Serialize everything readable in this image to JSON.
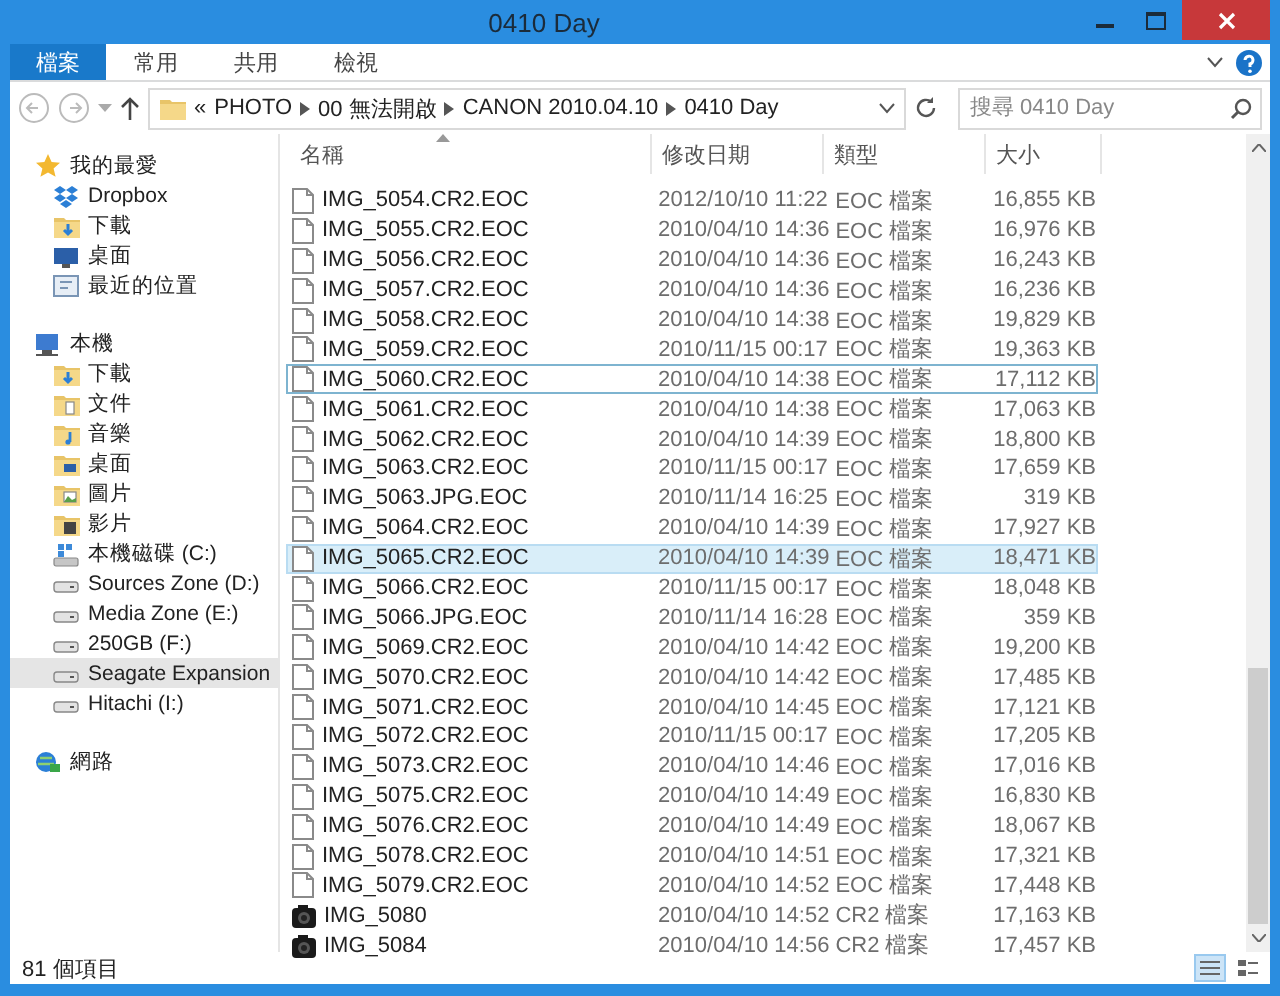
{
  "window": {
    "title": "0410 Day"
  },
  "ribbon": {
    "tabs": [
      {
        "label": "檔案",
        "selected": true
      },
      {
        "label": "常用",
        "selected": false
      },
      {
        "label": "共用",
        "selected": false
      },
      {
        "label": "檢視",
        "selected": false
      }
    ]
  },
  "address_bar": {
    "overflow": "«",
    "path": [
      "PHOTO",
      "00 無法開啟",
      "CANON 2010.04.10",
      "0410 Day"
    ]
  },
  "search": {
    "placeholder": "搜尋 0410 Day"
  },
  "navigation": [
    {
      "label": "我的最愛",
      "kind": "star",
      "selected": false,
      "children": [
        {
          "label": "Dropbox",
          "kind": "dropbox",
          "selected": false
        },
        {
          "label": "下載",
          "kind": "folder-download",
          "selected": false
        },
        {
          "label": "桌面",
          "kind": "desktop",
          "selected": false
        },
        {
          "label": "最近的位置",
          "kind": "recent",
          "selected": false
        }
      ]
    },
    {
      "label": "本機",
      "kind": "computer",
      "selected": false,
      "children": [
        {
          "label": "下載",
          "kind": "folder-download",
          "selected": false
        },
        {
          "label": "文件",
          "kind": "folder-doc",
          "selected": false
        },
        {
          "label": "音樂",
          "kind": "folder-music",
          "selected": false
        },
        {
          "label": "桌面",
          "kind": "folder-desktop",
          "selected": false
        },
        {
          "label": "圖片",
          "kind": "folder-picture",
          "selected": false
        },
        {
          "label": "影片",
          "kind": "folder-video",
          "selected": false
        },
        {
          "label": "本機磁碟 (C:)",
          "kind": "system-drive",
          "selected": false
        },
        {
          "label": "Sources Zone (D:)",
          "kind": "drive",
          "selected": false
        },
        {
          "label": "Media Zone (E:)",
          "kind": "drive",
          "selected": false
        },
        {
          "label": "250GB (F:)",
          "kind": "drive",
          "selected": false
        },
        {
          "label": "Seagate Expansion",
          "kind": "drive",
          "selected": true
        },
        {
          "label": "Hitachi (I:)",
          "kind": "drive",
          "selected": false
        }
      ]
    },
    {
      "label": "網路",
      "kind": "network",
      "selected": false
    }
  ],
  "file_list": {
    "columns": [
      {
        "label": "名稱",
        "sorted": true
      },
      {
        "label": "修改日期",
        "sorted": false
      },
      {
        "label": "類型",
        "sorted": false
      },
      {
        "label": "大小",
        "sorted": false
      }
    ],
    "rows": [
      {
        "name": "IMG_5054.CR2.EOC",
        "modified": "2012/10/10 11:22",
        "type": "EOC 檔案",
        "size": "16,855 KB",
        "kind": "eoc",
        "selected": false,
        "focused": false
      },
      {
        "name": "IMG_5055.CR2.EOC",
        "modified": "2010/04/10 14:36",
        "type": "EOC 檔案",
        "size": "16,976 KB",
        "kind": "eoc",
        "selected": false,
        "focused": false
      },
      {
        "name": "IMG_5056.CR2.EOC",
        "modified": "2010/04/10 14:36",
        "type": "EOC 檔案",
        "size": "16,243 KB",
        "kind": "eoc",
        "selected": false,
        "focused": false
      },
      {
        "name": "IMG_5057.CR2.EOC",
        "modified": "2010/04/10 14:36",
        "type": "EOC 檔案",
        "size": "16,236 KB",
        "kind": "eoc",
        "selected": false,
        "focused": false
      },
      {
        "name": "IMG_5058.CR2.EOC",
        "modified": "2010/04/10 14:38",
        "type": "EOC 檔案",
        "size": "19,829 KB",
        "kind": "eoc",
        "selected": false,
        "focused": false
      },
      {
        "name": "IMG_5059.CR2.EOC",
        "modified": "2010/11/15 00:17",
        "type": "EOC 檔案",
        "size": "19,363 KB",
        "kind": "eoc",
        "selected": false,
        "focused": false
      },
      {
        "name": "IMG_5060.CR2.EOC",
        "modified": "2010/04/10 14:38",
        "type": "EOC 檔案",
        "size": "17,112 KB",
        "kind": "eoc",
        "selected": false,
        "focused": true
      },
      {
        "name": "IMG_5061.CR2.EOC",
        "modified": "2010/04/10 14:38",
        "type": "EOC 檔案",
        "size": "17,063 KB",
        "kind": "eoc",
        "selected": false,
        "focused": false
      },
      {
        "name": "IMG_5062.CR2.EOC",
        "modified": "2010/04/10 14:39",
        "type": "EOC 檔案",
        "size": "18,800 KB",
        "kind": "eoc",
        "selected": false,
        "focused": false
      },
      {
        "name": "IMG_5063.CR2.EOC",
        "modified": "2010/11/15 00:17",
        "type": "EOC 檔案",
        "size": "17,659 KB",
        "kind": "eoc",
        "selected": false,
        "focused": false
      },
      {
        "name": "IMG_5063.JPG.EOC",
        "modified": "2010/11/14 16:25",
        "type": "EOC 檔案",
        "size": "319 KB",
        "kind": "eoc",
        "selected": false,
        "focused": false
      },
      {
        "name": "IMG_5064.CR2.EOC",
        "modified": "2010/04/10 14:39",
        "type": "EOC 檔案",
        "size": "17,927 KB",
        "kind": "eoc",
        "selected": false,
        "focused": false
      },
      {
        "name": "IMG_5065.CR2.EOC",
        "modified": "2010/04/10 14:39",
        "type": "EOC 檔案",
        "size": "18,471 KB",
        "kind": "eoc",
        "selected": true,
        "focused": false
      },
      {
        "name": "IMG_5066.CR2.EOC",
        "modified": "2010/11/15 00:17",
        "type": "EOC 檔案",
        "size": "18,048 KB",
        "kind": "eoc",
        "selected": false,
        "focused": false
      },
      {
        "name": "IMG_5066.JPG.EOC",
        "modified": "2010/11/14 16:28",
        "type": "EOC 檔案",
        "size": "359 KB",
        "kind": "eoc",
        "selected": false,
        "focused": false
      },
      {
        "name": "IMG_5069.CR2.EOC",
        "modified": "2010/04/10 14:42",
        "type": "EOC 檔案",
        "size": "19,200 KB",
        "kind": "eoc",
        "selected": false,
        "focused": false
      },
      {
        "name": "IMG_5070.CR2.EOC",
        "modified": "2010/04/10 14:42",
        "type": "EOC 檔案",
        "size": "17,485 KB",
        "kind": "eoc",
        "selected": false,
        "focused": false
      },
      {
        "name": "IMG_5071.CR2.EOC",
        "modified": "2010/04/10 14:45",
        "type": "EOC 檔案",
        "size": "17,121 KB",
        "kind": "eoc",
        "selected": false,
        "focused": false
      },
      {
        "name": "IMG_5072.CR2.EOC",
        "modified": "2010/11/15 00:17",
        "type": "EOC 檔案",
        "size": "17,205 KB",
        "kind": "eoc",
        "selected": false,
        "focused": false
      },
      {
        "name": "IMG_5073.CR2.EOC",
        "modified": "2010/04/10 14:46",
        "type": "EOC 檔案",
        "size": "17,016 KB",
        "kind": "eoc",
        "selected": false,
        "focused": false
      },
      {
        "name": "IMG_5075.CR2.EOC",
        "modified": "2010/04/10 14:49",
        "type": "EOC 檔案",
        "size": "16,830 KB",
        "kind": "eoc",
        "selected": false,
        "focused": false
      },
      {
        "name": "IMG_5076.CR2.EOC",
        "modified": "2010/04/10 14:49",
        "type": "EOC 檔案",
        "size": "18,067 KB",
        "kind": "eoc",
        "selected": false,
        "focused": false
      },
      {
        "name": "IMG_5078.CR2.EOC",
        "modified": "2010/04/10 14:51",
        "type": "EOC 檔案",
        "size": "17,321 KB",
        "kind": "eoc",
        "selected": false,
        "focused": false
      },
      {
        "name": "IMG_5079.CR2.EOC",
        "modified": "2010/04/10 14:52",
        "type": "EOC 檔案",
        "size": "17,448 KB",
        "kind": "eoc",
        "selected": false,
        "focused": false
      },
      {
        "name": "IMG_5080",
        "modified": "2010/04/10 14:52",
        "type": "CR2 檔案",
        "size": "17,163 KB",
        "kind": "raw",
        "selected": false,
        "focused": false
      },
      {
        "name": "IMG_5084",
        "modified": "2010/04/10 14:56",
        "type": "CR2 檔案",
        "size": "17,457 KB",
        "kind": "raw",
        "selected": false,
        "focused": false
      }
    ]
  },
  "status_bar": {
    "item_count": "81 個項目",
    "views": [
      {
        "kind": "details",
        "selected": true
      },
      {
        "kind": "tiles",
        "selected": false
      }
    ]
  }
}
